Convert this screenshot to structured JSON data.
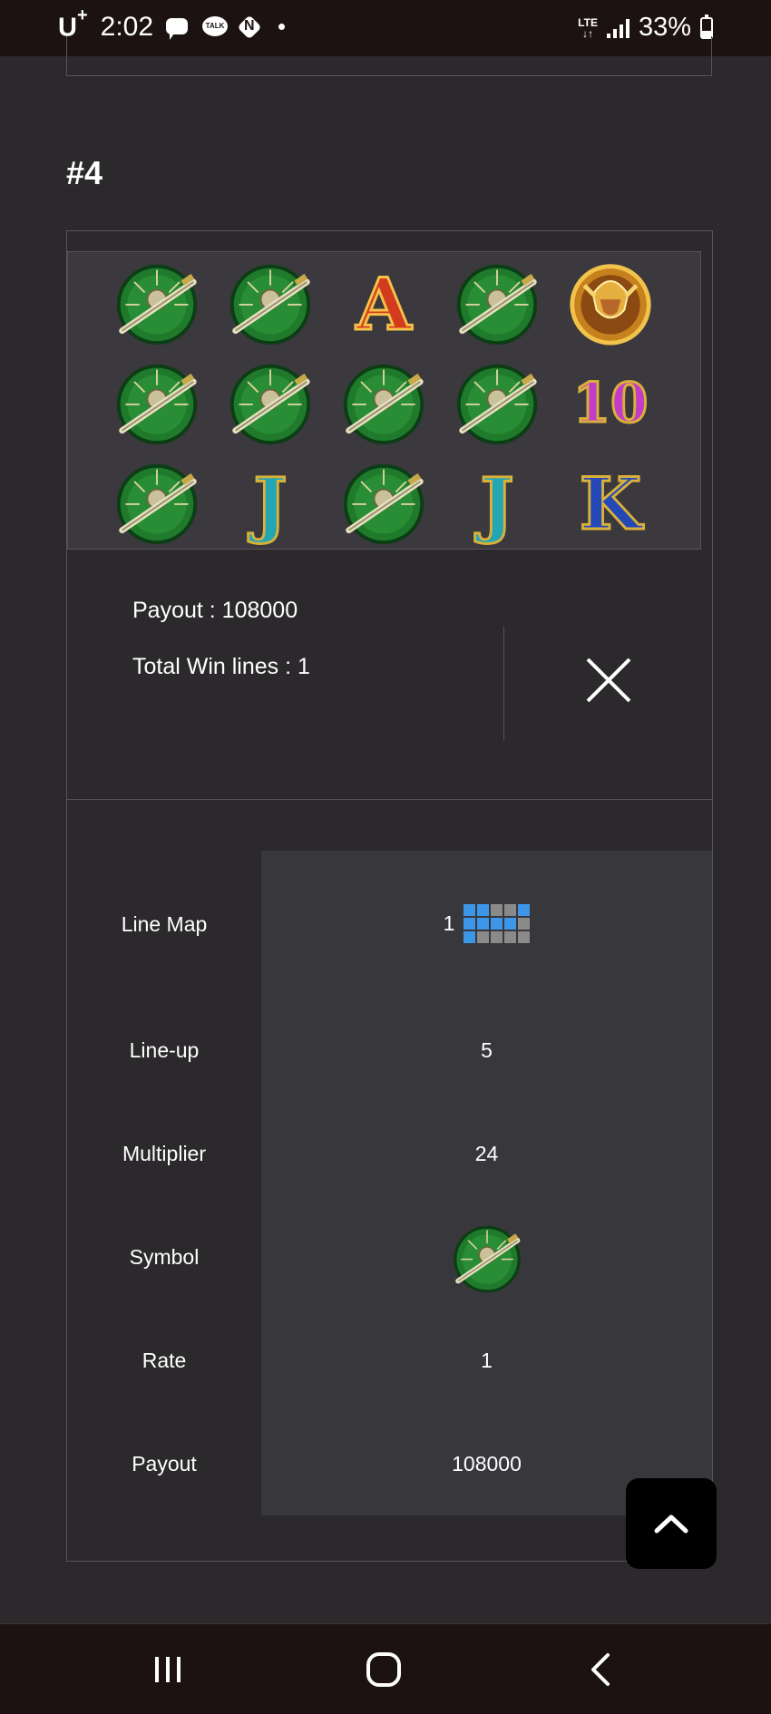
{
  "status_bar": {
    "carrier": "U",
    "carrier_sup": "+",
    "time": "2:02",
    "notification_icons": [
      "message-icon",
      "kakaotalk-icon",
      "naver-icon"
    ],
    "talk_label": "TALK",
    "naver_label": "N",
    "network": "LTE",
    "battery_text": "33%",
    "battery_level": 0.33
  },
  "section": {
    "title": "#4"
  },
  "reels": {
    "rows": [
      [
        "shield-sword",
        "shield-sword",
        "A",
        "shield-sword",
        "warrior"
      ],
      [
        "shield-sword",
        "shield-sword",
        "shield-sword",
        "shield-sword",
        "10"
      ],
      [
        "shield-sword",
        "J",
        "shield-sword",
        "J",
        "K"
      ]
    ]
  },
  "summary": {
    "payout_text": "Payout : 108000",
    "winlines_text": "Total Win lines : 1"
  },
  "details": {
    "line_map_label": "Line Map",
    "line_map_number": "1",
    "line_map_grid": [
      [
        1,
        1,
        0,
        0,
        1
      ],
      [
        1,
        1,
        1,
        1,
        0
      ],
      [
        1,
        0,
        0,
        0,
        0
      ]
    ],
    "lineup_label": "Line-up",
    "lineup_value": "5",
    "multiplier_label": "Multiplier",
    "multiplier_value": "24",
    "symbol_label": "Symbol",
    "symbol_value": "shield-sword",
    "rate_label": "Rate",
    "rate_value": "1",
    "payout_label": "Payout",
    "payout_value": "108000"
  },
  "colors": {
    "background": "#2b292b",
    "grid_active": "#3d97e8",
    "grid_inactive": "#8a8a8a"
  }
}
